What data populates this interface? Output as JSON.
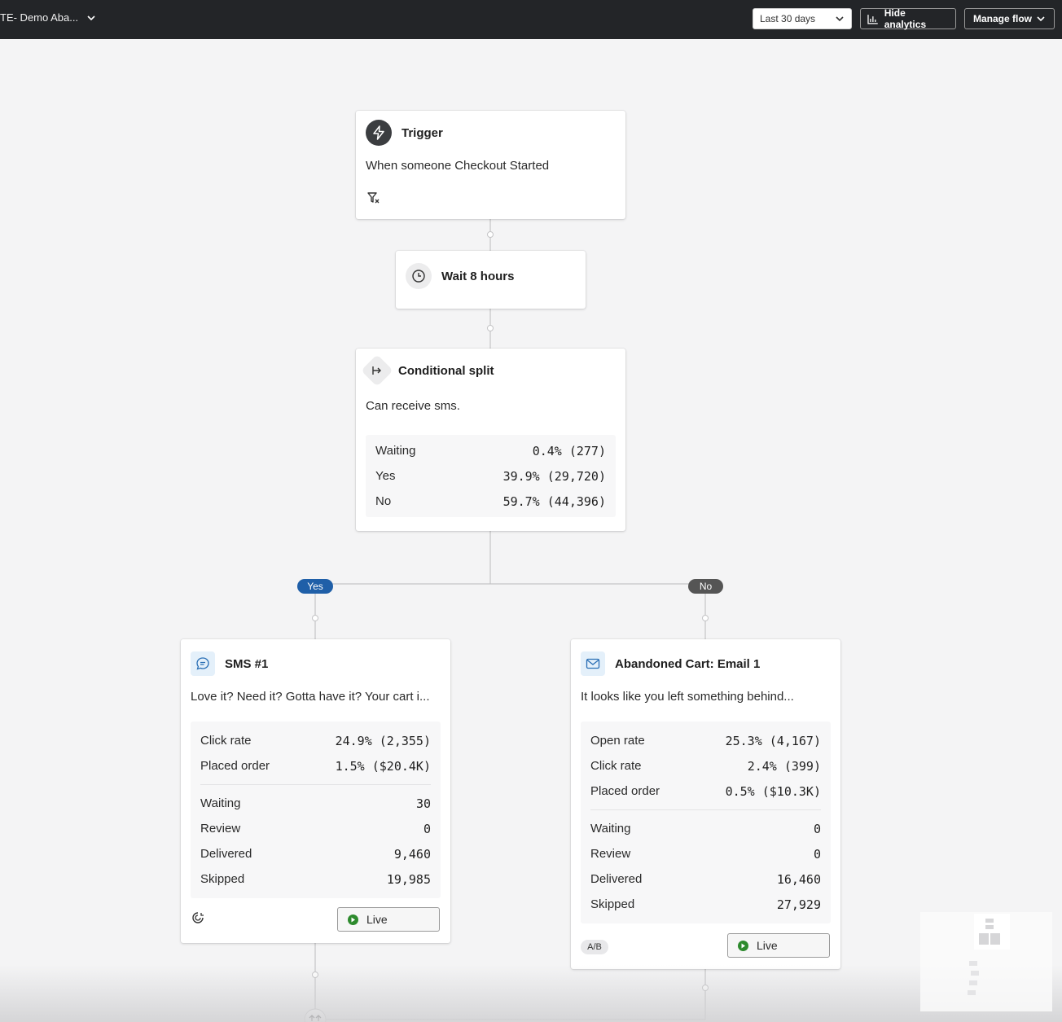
{
  "topbar": {
    "flow_name": "TE- Demo Aba...",
    "date_range": "Last 30 days",
    "hide_analytics": "Hide analytics",
    "manage_flow": "Manage flow"
  },
  "trigger": {
    "title": "Trigger",
    "description": "When someone Checkout Started"
  },
  "wait": {
    "title": "Wait 8 hours"
  },
  "split": {
    "title": "Conditional split",
    "description": "Can receive sms.",
    "rows": [
      {
        "label": "Waiting",
        "value": "0.4% (277)"
      },
      {
        "label": "Yes",
        "value": "39.9% (29,720)"
      },
      {
        "label": "No",
        "value": "59.7% (44,396)"
      }
    ]
  },
  "branches": {
    "yes_label": "Yes",
    "no_label": "No"
  },
  "sms": {
    "title": "SMS #1",
    "description": "Love it? Need it? Gotta have it? Your cart i...",
    "metrics": [
      {
        "label": "Click rate",
        "value": "24.9% (2,355)"
      },
      {
        "label": "Placed order",
        "value": "1.5% ($20.4K)"
      }
    ],
    "counts": [
      {
        "label": "Waiting",
        "value": "30"
      },
      {
        "label": "Review",
        "value": "0"
      },
      {
        "label": "Delivered",
        "value": "9,460"
      },
      {
        "label": "Skipped",
        "value": "19,985"
      }
    ],
    "status": "Live"
  },
  "email": {
    "title": "Abandoned Cart: Email 1",
    "description": "It looks like you left something behind...",
    "metrics": [
      {
        "label": "Open rate",
        "value": "25.3% (4,167)"
      },
      {
        "label": "Click rate",
        "value": "2.4% (399)"
      },
      {
        "label": "Placed order",
        "value": "0.5% ($10.3K)"
      }
    ],
    "counts": [
      {
        "label": "Waiting",
        "value": "0"
      },
      {
        "label": "Review",
        "value": "0"
      },
      {
        "label": "Delivered",
        "value": "16,460"
      },
      {
        "label": "Skipped",
        "value": "27,929"
      }
    ],
    "ab_badge": "A/B",
    "status": "Live"
  },
  "colors": {
    "topbar": "#232528",
    "yes_pill": "#1f5fa8",
    "no_pill": "#555555",
    "live_green": "#2d8a2d",
    "sms_icon_bg": "#e4f0fa",
    "connector": "#c4c4c6"
  }
}
